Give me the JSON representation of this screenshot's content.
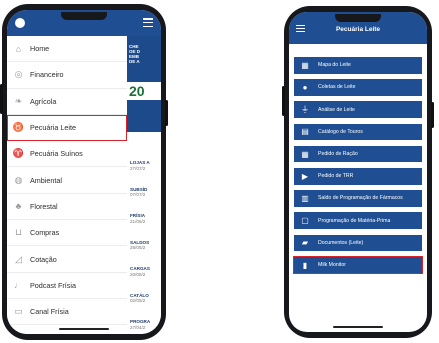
{
  "phone1": {
    "menu": [
      {
        "label": "Home",
        "icon": "home-icon"
      },
      {
        "label": "Financeiro",
        "icon": "coin-icon"
      },
      {
        "label": "Agrícola",
        "icon": "leaf-icon"
      },
      {
        "label": "Pecuária Leite",
        "icon": "cow-icon",
        "active": true
      },
      {
        "label": "Pecuária Suínos",
        "icon": "pig-icon"
      },
      {
        "label": "Ambiental",
        "icon": "globe-icon"
      },
      {
        "label": "Florestal",
        "icon": "tree-icon"
      },
      {
        "label": "Compras",
        "icon": "cart-icon"
      },
      {
        "label": "Cotação",
        "icon": "chart-icon"
      },
      {
        "label": "Podcast Frísia",
        "icon": "microphone-icon"
      },
      {
        "label": "Canal Frísia",
        "icon": "video-icon"
      },
      {
        "label": "Frísia em Foco",
        "icon": "target-icon"
      }
    ],
    "banner_lines": [
      "CHE",
      "OE D",
      "EMB",
      "DE A"
    ],
    "banner_year": "20",
    "news": [
      {
        "title": "LOJAS A",
        "date": "27/07/2"
      },
      {
        "title": "SUBSÍD",
        "date": "07/07/2"
      },
      {
        "title": "FRÍSIA",
        "date": "21/06/2"
      },
      {
        "title": "SALDOS",
        "date": "26/05/2"
      },
      {
        "title": "CARGAS",
        "date": "20/05/2"
      },
      {
        "title": "CATÁLO",
        "date": "02/05/2"
      },
      {
        "title": "PROGRA",
        "date": "27/04/2"
      }
    ]
  },
  "phone2": {
    "title": "Pecuária Leite",
    "items": [
      {
        "label": "Mapa do Leite",
        "icon": "map-icon"
      },
      {
        "label": "Coletas de Leite",
        "icon": "location-pin-icon"
      },
      {
        "label": "Análise de Leite",
        "icon": "flask-icon"
      },
      {
        "label": "Catálogo de Touros",
        "icon": "book-icon"
      },
      {
        "label": "Pedido de Ração",
        "icon": "grid-icon"
      },
      {
        "label": "Pedido de TRR",
        "icon": "truck-icon"
      },
      {
        "label": "Saldo de Programação de Fármacos",
        "icon": "bar-chart-icon"
      },
      {
        "label": "Programação de Matéria-Prima",
        "icon": "calendar-icon"
      },
      {
        "label": "Documentos (Leite)",
        "icon": "folder-icon"
      },
      {
        "label": "Milk Monitor",
        "icon": "milk-icon",
        "highlighted": true
      }
    ]
  },
  "colors": {
    "primary": "#1f4f92",
    "highlight": "#d8232a"
  }
}
